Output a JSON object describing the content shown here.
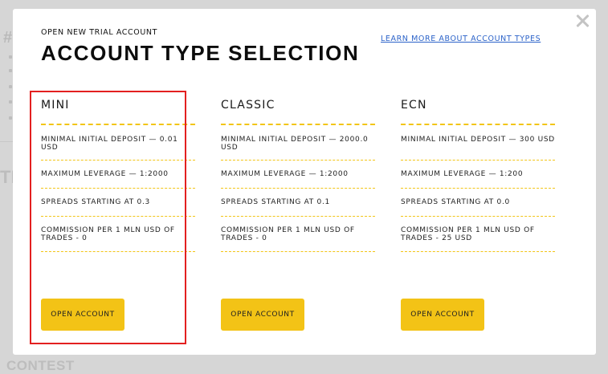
{
  "background": {
    "fragment_hash": "#",
    "fragment_tr": "TR",
    "fragment_contest": "CONTEST"
  },
  "modal": {
    "subtitle": "OPEN NEW TRIAL ACCOUNT",
    "title": "ACCOUNT TYPE SELECTION",
    "learn_more": "LEARN MORE ABOUT ACCOUNT TYPES",
    "close_icon": "close-icon"
  },
  "plans": [
    {
      "name": "MINI",
      "deposit": "MINIMAL INITIAL DEPOSIT — 0.01 USD",
      "leverage": "MAXIMUM LEVERAGE — 1:2000",
      "spreads": "SPREADS STARTING AT 0.3",
      "commission": "COMMISSION PER 1 MLN USD OF TRADES - 0",
      "button": "OPEN ACCOUNT",
      "highlighted": true
    },
    {
      "name": "CLASSIC",
      "deposit": "MINIMAL INITIAL DEPOSIT — 2000.0 USD",
      "leverage": "MAXIMUM LEVERAGE — 1:2000",
      "spreads": "SPREADS STARTING AT 0.1",
      "commission": "COMMISSION PER 1 MLN USD OF TRADES - 0",
      "button": "OPEN ACCOUNT",
      "highlighted": false
    },
    {
      "name": "ECN",
      "deposit": "MINIMAL INITIAL DEPOSIT — 300 USD",
      "leverage": "MAXIMUM LEVERAGE — 1:200",
      "spreads": "SPREADS STARTING AT 0.0",
      "commission": "COMMISSION PER 1 MLN USD OF TRADES - 25 USD",
      "button": "OPEN ACCOUNT",
      "highlighted": false
    }
  ],
  "colors": {
    "accent": "#f3c316",
    "link": "#2c63c9",
    "highlight": "#e32020"
  }
}
